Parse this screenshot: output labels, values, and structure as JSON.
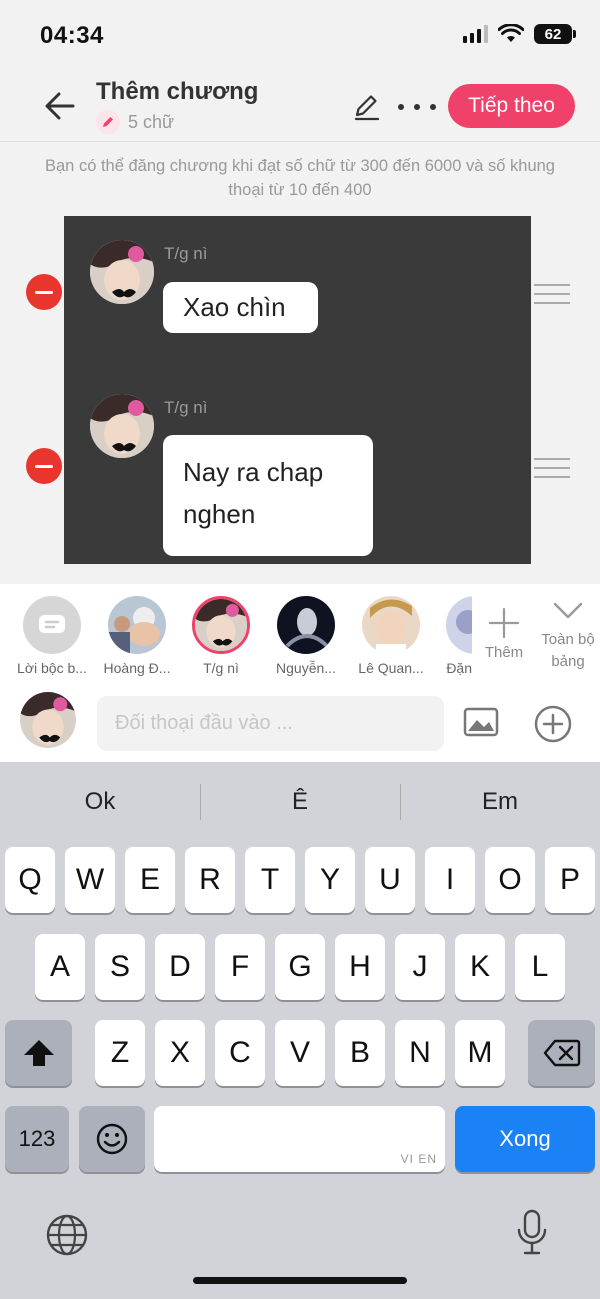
{
  "status_bar": {
    "time": "04:34",
    "battery": "62"
  },
  "header": {
    "title": "Thêm chương",
    "word_count": "5 chữ",
    "next_label": "Tiếp theo"
  },
  "hint": "Bạn có thể đăng chương khi đạt số chữ từ 300 đến 6000 và số khung thoại từ 10 đến 400",
  "messages": [
    {
      "speaker": "T/g nì",
      "text": "Xao chìn"
    },
    {
      "speaker": "T/g nì",
      "text": "Nay ra chap nghen"
    }
  ],
  "characters": [
    {
      "name": "Lời bộc b..."
    },
    {
      "name": "Hoàng Đ..."
    },
    {
      "name": "T/g nì"
    },
    {
      "name": "Nguyễn..."
    },
    {
      "name": "Lê Quan..."
    },
    {
      "name": "Đặn"
    }
  ],
  "add_character_label": "Thêm",
  "expand_label": "Toàn bộ bảng",
  "input": {
    "placeholder": "Đối thoại đầu vào ...",
    "value": ""
  },
  "keyboard": {
    "suggestions": [
      "Ok",
      "Ê",
      "Em"
    ],
    "row1": [
      "Q",
      "W",
      "E",
      "R",
      "T",
      "Y",
      "U",
      "I",
      "O",
      "P"
    ],
    "row2": [
      "A",
      "S",
      "D",
      "F",
      "G",
      "H",
      "J",
      "K",
      "L"
    ],
    "row3": [
      "Z",
      "X",
      "C",
      "V",
      "B",
      "N",
      "M"
    ],
    "numbers_label": "123",
    "space_hint": "VI EN",
    "done_label": "Xong"
  },
  "colors": {
    "accent": "#f0416a",
    "chat_bg": "#3a3a3a",
    "keyboard_bg": "#d1d3d9",
    "done": "#1a82f5",
    "remove": "#e8362f"
  }
}
